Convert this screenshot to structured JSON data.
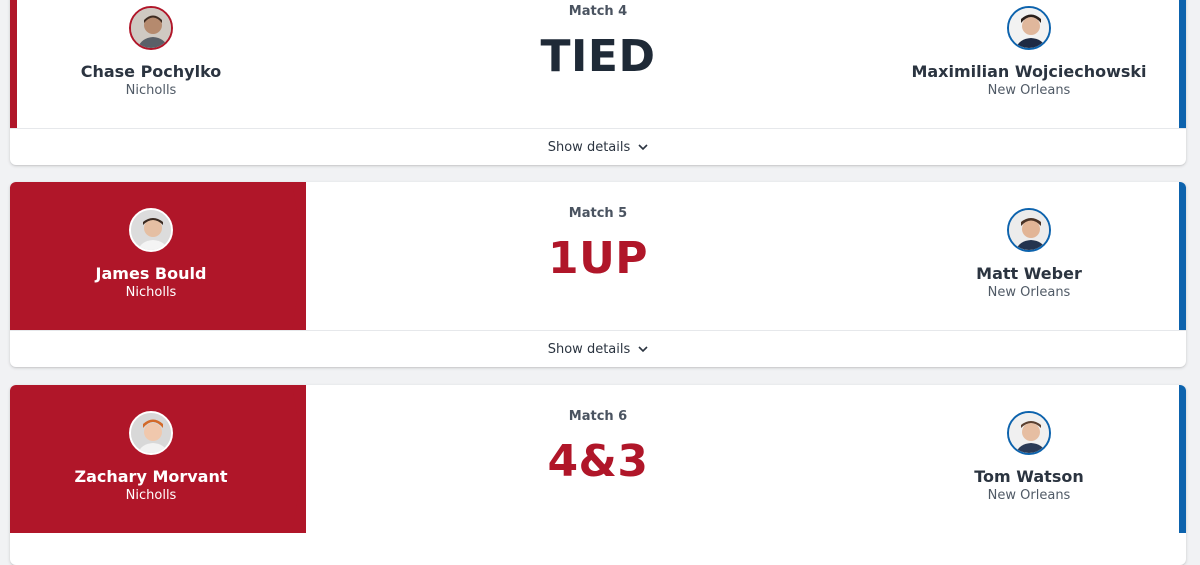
{
  "colors": {
    "home": "#b01629",
    "away": "#0d63ad"
  },
  "matches": [
    {
      "label": "Match 4",
      "result": "TIED",
      "left": {
        "name": "Chase Pochylko",
        "school": "Nicholls",
        "avatar": "player-photo"
      },
      "right": {
        "name": "Maximilian Wojciechowski",
        "school": "New Orleans",
        "avatar": "player-photo"
      },
      "details_label": "Show details"
    },
    {
      "label": "Match 5",
      "result": "1UP",
      "winner": "left",
      "left": {
        "name": "James Bould",
        "school": "Nicholls",
        "avatar": "player-photo"
      },
      "right": {
        "name": "Matt Weber",
        "school": "New Orleans",
        "avatar": "player-photo"
      },
      "details_label": "Show details"
    },
    {
      "label": "Match 6",
      "result": "4&3",
      "winner": "left",
      "left": {
        "name": "Zachary Morvant",
        "school": "Nicholls",
        "avatar": "player-photo"
      },
      "right": {
        "name": "Tom Watson",
        "school": "New Orleans",
        "avatar": "player-photo"
      }
    }
  ]
}
